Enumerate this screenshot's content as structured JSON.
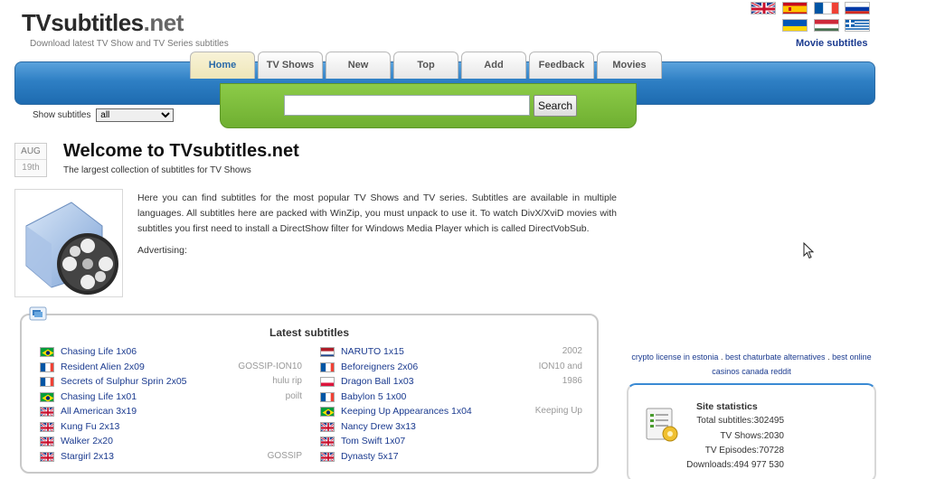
{
  "header": {
    "logo_main": "TVsubtitles",
    "logo_suffix": ".net",
    "tagline": "Download latest TV Show and TV Series subtitles",
    "movie_subtitles_link": "Movie subtitles"
  },
  "flags": [
    {
      "name": "uk-flag",
      "country": "English"
    },
    {
      "name": "spain-flag",
      "country": "Spanish"
    },
    {
      "name": "france-flag",
      "country": "French"
    },
    {
      "name": "russia-flag",
      "country": "Russian"
    },
    {
      "name": "ukraine-flag",
      "country": "Ukrainian"
    },
    {
      "name": "hungary-flag",
      "country": "Hungarian"
    },
    {
      "name": "greece-flag",
      "country": "Greek"
    }
  ],
  "nav": {
    "tabs": [
      "Home",
      "TV Shows",
      "New",
      "Top",
      "Add",
      "Feedback",
      "Movies"
    ],
    "active": "Home"
  },
  "search": {
    "value": "",
    "button_label": "Search"
  },
  "filter": {
    "label": "Show subtitles",
    "selected": "all"
  },
  "welcome": {
    "month": "AUG",
    "day": "19th",
    "title": "Welcome to TVsubtitles.net",
    "subtitle": "The largest collection of subtitles for TV Shows",
    "intro": "Here you can find subtitles for the most popular TV Shows and TV series. Subtitles are available in multiple languages. All subtitles here are packed with WinZip, you must unpack to use it. To watch DivX/XviD movies with subtitles you first need to install a DirectShow filter for Windows Media Player which is called DirectVobSub.",
    "advertising": "Advertising:"
  },
  "latest": {
    "title": "Latest subtitles",
    "left": [
      {
        "flag": "br",
        "name": "Chasing Life 1x06",
        "release": ""
      },
      {
        "flag": "fr",
        "name": "Resident Alien 2x09",
        "release": "GOSSIP-ION10"
      },
      {
        "flag": "fr",
        "name": "Secrets of Sulphur Sprin 2x05",
        "release": "hulu rip"
      },
      {
        "flag": "br",
        "name": "Chasing Life 1x01",
        "release": "poilt"
      },
      {
        "flag": "uk",
        "name": "All American 3x19",
        "release": ""
      },
      {
        "flag": "uk",
        "name": "Kung Fu 2x13",
        "release": ""
      },
      {
        "flag": "uk",
        "name": "Walker 2x20",
        "release": ""
      },
      {
        "flag": "uk",
        "name": "Stargirl 2x13",
        "release": "GOSSIP"
      }
    ],
    "right": [
      {
        "flag": "nl",
        "name": "NARUTO 1x15",
        "release": "2002"
      },
      {
        "flag": "fr",
        "name": "Beforeigners 2x06",
        "release": "ION10 and"
      },
      {
        "flag": "pl",
        "name": "Dragon Ball 1x03",
        "release": "1986"
      },
      {
        "flag": "fr",
        "name": "Babylon 5 1x00",
        "release": ""
      },
      {
        "flag": "br",
        "name": "Keeping Up Appearances 1x04",
        "release": "Keeping Up"
      },
      {
        "flag": "uk",
        "name": "Nancy Drew 3x13",
        "release": ""
      },
      {
        "flag": "uk",
        "name": "Tom Swift 1x07",
        "release": ""
      },
      {
        "flag": "uk",
        "name": "Dynasty 5x17",
        "release": ""
      }
    ]
  },
  "ads": {
    "link1": "crypto license in estonia",
    "link2": "best chaturbate alternatives",
    "link3": "best online casinos canada reddit",
    "sep": "."
  },
  "stats": {
    "title": "Site statistics",
    "total_subtitles": "Total subtitles:302495",
    "tv_shows": "TV Shows:2030",
    "tv_episodes": "TV Episodes:70728",
    "downloads": "Downloads:494 977 530"
  },
  "colors": {
    "nav_blue": "#2e7fc4",
    "search_green": "#7dbd3c",
    "link_blue": "#1a3a8f"
  }
}
